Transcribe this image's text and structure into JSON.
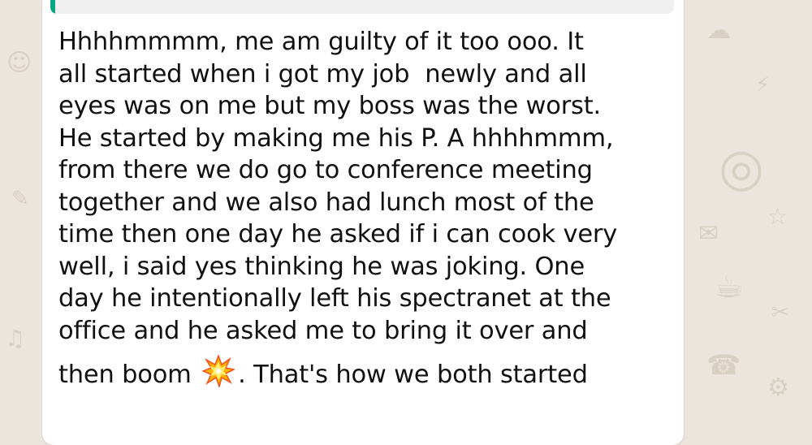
{
  "chat": {
    "quoted_message": {
      "accent_color": "#06a884"
    },
    "message": {
      "lines": [
        "Hhhhmmmm, me am guilty of it too ooo. It",
        "all started when i got my job  newly and all",
        "eyes was on me but my boss was the worst.",
        "He started by making me his P. A hhhhmmm,",
        "from there we do go to conference meeting",
        "together and we also had lunch most of the",
        "time then one day he asked if i can cook very",
        "well, i said yes thinking he was joking. One",
        "day he intentionally left his spectranet at the",
        "office and he asked me to bring it over and"
      ],
      "last_line_before_emoji": "then boom ",
      "last_line_after_emoji": ". That's how we both started",
      "emoji_icon": "collision-emoji-icon"
    },
    "colors": {
      "wallpaper": "#ece5dd",
      "bubble": "#ffffff",
      "text": "#111111"
    }
  }
}
